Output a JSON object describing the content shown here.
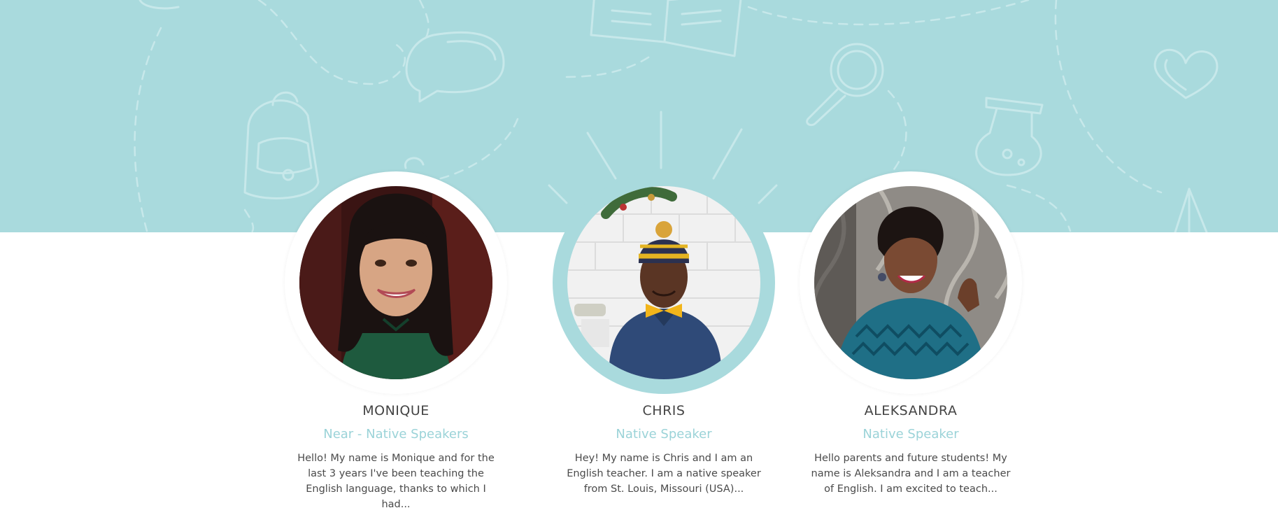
{
  "colors": {
    "hero_bg": "#a9dadd",
    "accent": "#9bd3d8",
    "name_text": "#444444",
    "bio_text": "#4a4a4a"
  },
  "hero": {
    "doodles": [
      "open-book-icon",
      "speech-bubble-icon",
      "backpack-icon",
      "magnifier-icon",
      "flask-icon",
      "heart-icon",
      "cone-icon"
    ]
  },
  "teachers": [
    {
      "name": "MONIQUE",
      "role": "Near - Native Speakers",
      "bio": "Hello! My name is Monique and for the last 3 years I've been teaching the English language, thanks to which I had...",
      "highlighted": false
    },
    {
      "name": "CHRIS",
      "role": "Native Speaker",
      "bio": "Hey! My name is Chris and I am an English teacher. I am a native speaker from St. Louis, Missouri (USA)...",
      "highlighted": true
    },
    {
      "name": "ALEKSANDRA",
      "role": "Native Speaker",
      "bio": "Hello parents and future students! My name is Aleksandra and I am a teacher of English. I am excited to teach...",
      "highlighted": false
    }
  ]
}
